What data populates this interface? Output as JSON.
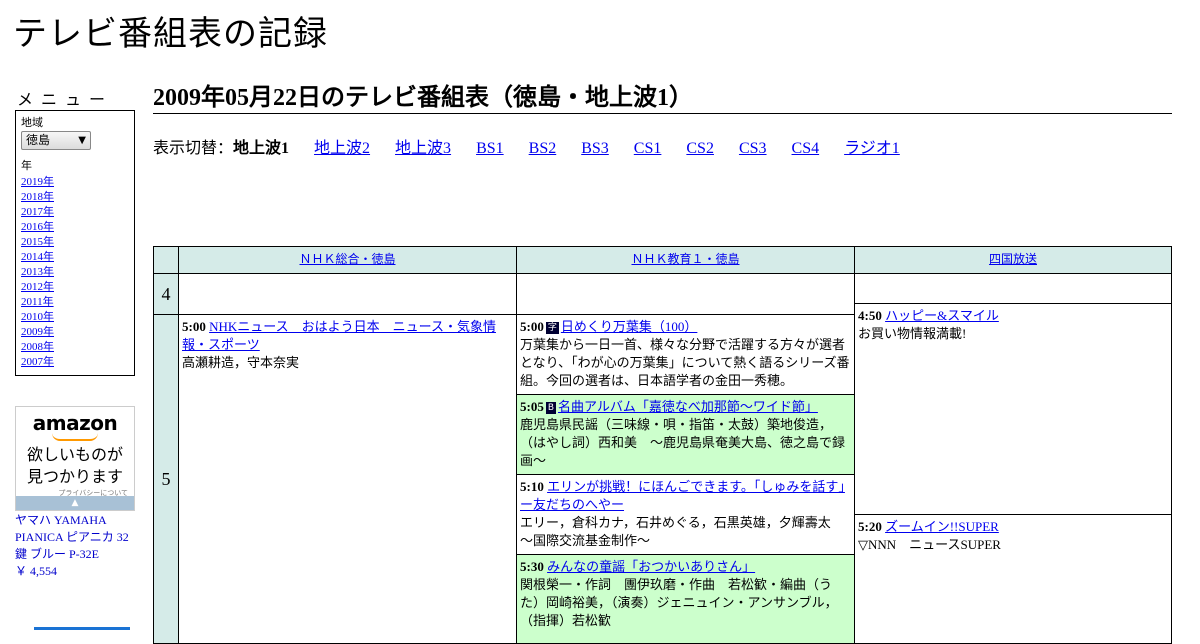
{
  "site": {
    "title": "テレビ番組表の記録"
  },
  "sidebar": {
    "menu_title": "メニュー",
    "region_label": "地域",
    "region_value": "徳島",
    "year_label": "年",
    "years": [
      "2019年",
      "2018年",
      "2017年",
      "2016年",
      "2015年",
      "2014年",
      "2013年",
      "2012年",
      "2011年",
      "2010年",
      "2009年",
      "2008年",
      "2007年"
    ]
  },
  "ad": {
    "logo": "amazon",
    "tagline_line1": "欲しいものが",
    "tagline_line2": "見つかります",
    "privacy": "プライバシーについて",
    "product_name": "ヤマハ YAMAHA PIANICA ピアニカ 32鍵 ブルー P-32E",
    "product_price": "￥ 4,554"
  },
  "main": {
    "heading": "2009年05月22日のテレビ番組表（徳島・地上波1）",
    "switch_label": "表示切替：",
    "current_tab": "地上波1",
    "tabs": [
      "地上波2",
      "地上波3",
      "BS1",
      "BS2",
      "BS3",
      "CS1",
      "CS2",
      "CS3",
      "CS4",
      "ラジオ1"
    ]
  },
  "schedule": {
    "channels": [
      "ＮＨＫ総合・徳島",
      "ＮＨＫ教育１・徳島",
      "四国放送"
    ],
    "hours": [
      "4",
      "5"
    ],
    "programs": {
      "nhk_500": {
        "time": "5:00",
        "title": "NHKニュース　おはよう日本　ニュース・気象情報・スポーツ",
        "desc": "高瀬耕造，守本奈実"
      },
      "edu_500": {
        "time": "5:00",
        "badge": "字",
        "title": "日めくり万葉集（100）",
        "desc": "万葉集から一日一首、様々な分野で活躍する方々が選者となり、「わが心の万葉集」について熱く語るシリーズ番組。今回の選者は、日本語学者の金田一秀穂。"
      },
      "edu_505": {
        "time": "5:05",
        "badge": "B",
        "title": "名曲アルバム「嘉徳なべ加那節～ワイド節」",
        "desc": "鹿児島県民謡（三味線・唄・指笛・太鼓）築地俊造，（はやし詞）西和美　～鹿児島県奄美大島、徳之島で録画～"
      },
      "edu_510": {
        "time": "5:10",
        "title": "エリンが挑戦！にほんごできます。「しゅみを話す」ー友だちのへやー",
        "desc": "エリー，倉科カナ，石井めぐる，石黒英雄，夕輝壽太　～国際交流基金制作～"
      },
      "edu_530": {
        "time": "5:30",
        "title": "みんなの童謡「おつかいありさん」",
        "desc": "関根榮一・作詞　團伊玖磨・作曲　若松歓・編曲（うた）岡崎裕美，（演奏）ジェニュイン・アンサンブル，（指揮）若松歓"
      },
      "jrt_450": {
        "time": "4:50",
        "title": "ハッピー&スマイル",
        "desc": "お買い物情報満載!"
      },
      "jrt_520": {
        "time": "5:20",
        "title": "ズームイン!!SUPER",
        "desc": "▽NNN　ニュースSUPER"
      }
    }
  },
  "colors": {
    "header_bg": "#d5ebe8",
    "edu_bg": "#ccffcc",
    "link": "#0000ee"
  }
}
